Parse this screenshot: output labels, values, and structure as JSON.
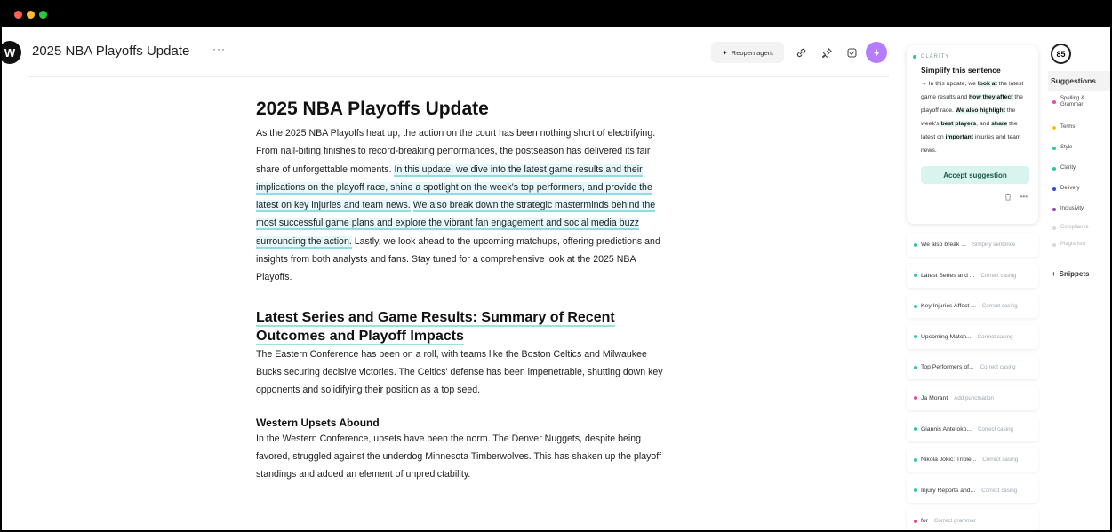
{
  "window": {
    "controls": [
      "close",
      "minimize",
      "maximize"
    ]
  },
  "header": {
    "logo": "W",
    "doc_title": "2025 NBA Playoffs Update",
    "more": "···",
    "agent_button": "Reopen agent",
    "icons": [
      "link-icon",
      "pin-icon",
      "shield-check-icon",
      "bolt-icon"
    ]
  },
  "doc": {
    "title": "2025 NBA Playoffs Update",
    "intro_a": "As the 2025 NBA Playoffs heat up, the action on the court has been nothing short of electrifying. From nail-biting finishes to record-breaking performances, the postseason has delivered its fair share of unforgettable moments. ",
    "intro_hl1": "In this update, we dive into the latest game results and their implications on the playoff race, shine a spotlight on the week's top performers, and provide the latest on key injuries and team news.",
    "intro_space": " ",
    "intro_hl2": "We also break down the strategic masterminds behind the most successful game plans and explore the vibrant fan engagement and social media buzz surrounding the action.",
    "intro_b": " Lastly, we look ahead to the upcoming matchups, offering predictions and insights from both analysts and fans. Stay tuned for a comprehensive look at the 2025 NBA Playoffs.",
    "h2": "Latest Series and Game Results: Summary of Recent Outcomes and Playoff Impacts",
    "p2": "The Eastern Conference has been on a roll, with teams like the Boston Celtics and Milwaukee Bucks securing decisive victories. The Celtics' defense has been impenetrable, shutting down key opponents and solidifying their position as a top seed.",
    "h3": "Western Upsets Abound",
    "p3": "In the Western Conference, upsets have been the norm. The Denver Nuggets, despite being favored, struggled against the underdog Minnesota Timberwolves. This has shaken up the playoff standings and added an element of unpredictability."
  },
  "card": {
    "category": "CLARITY",
    "title": "Simplify this sentence",
    "arrow": "→",
    "s1": " In this update, we ",
    "b1": "look at",
    "s2": " the latest game results and ",
    "b2": "how they affect",
    "s3": " the playoff race. ",
    "b3": "We also highlight",
    "s4": " the week's ",
    "b4": "best players",
    "s5": ", and ",
    "b5": "share",
    "s6": " the latest on ",
    "b6": "important",
    "s7": " injuries and team news.",
    "accept": "Accept suggestion",
    "icons": [
      "trash-icon",
      "more-icon"
    ]
  },
  "suggestions": [
    {
      "text": "We also break ...",
      "tag": "Simplify sentence",
      "color": "#2cc7a4"
    },
    {
      "text": "Latest Series and ...",
      "tag": "Correct casing",
      "color": "#2cc7a4"
    },
    {
      "text": "Key Injuries Affect ...",
      "tag": "Correct casing",
      "color": "#2cc7a4"
    },
    {
      "text": "Upcoming Match...",
      "tag": "Correct casing",
      "color": "#2cc7a4"
    },
    {
      "text": "Top Performers of...",
      "tag": "Correct casing",
      "color": "#2cc7a4"
    },
    {
      "text": "Ja Morant",
      "tag": "Add punctuation",
      "color": "#e24aa8"
    },
    {
      "text": "Giannis Antetoko...",
      "tag": "Correct casing",
      "color": "#2cc7a4"
    },
    {
      "text": "Nikola Jokic: Triple...",
      "tag": "Correct casing",
      "color": "#2cc7a4"
    },
    {
      "text": "Injury Reports and...",
      "tag": "Correct casing",
      "color": "#2cc7a4"
    },
    {
      "text": "for",
      "tag": "Correct grammar",
      "color": "#e24aa8"
    }
  ],
  "rail": {
    "score": "85",
    "tab": "Suggestions",
    "items": [
      {
        "label": "Spelling & Grammar",
        "color": "#e24aa8",
        "muted": false,
        "gap": 0
      },
      {
        "label": "Terms",
        "color": "#f3c623",
        "muted": false,
        "gap": 18
      },
      {
        "label": "Style",
        "color": "#2cc7a4",
        "muted": false,
        "gap": 16
      },
      {
        "label": "Clarity",
        "color": "#2cc7a4",
        "muted": false,
        "gap": 16
      },
      {
        "label": "Delivery",
        "color": "#2f4fd6",
        "muted": false,
        "gap": 16
      },
      {
        "label": "Inclusivity",
        "color": "#8e44ad",
        "muted": false,
        "gap": 16
      },
      {
        "label": "Compliance",
        "color": "#d8d8d8",
        "muted": true,
        "gap": 14
      },
      {
        "label": "Plagiarism",
        "color": "#d8d8d8",
        "muted": true,
        "gap": 12
      }
    ],
    "snippets": "Snippets",
    "snippets_icon": "+"
  }
}
